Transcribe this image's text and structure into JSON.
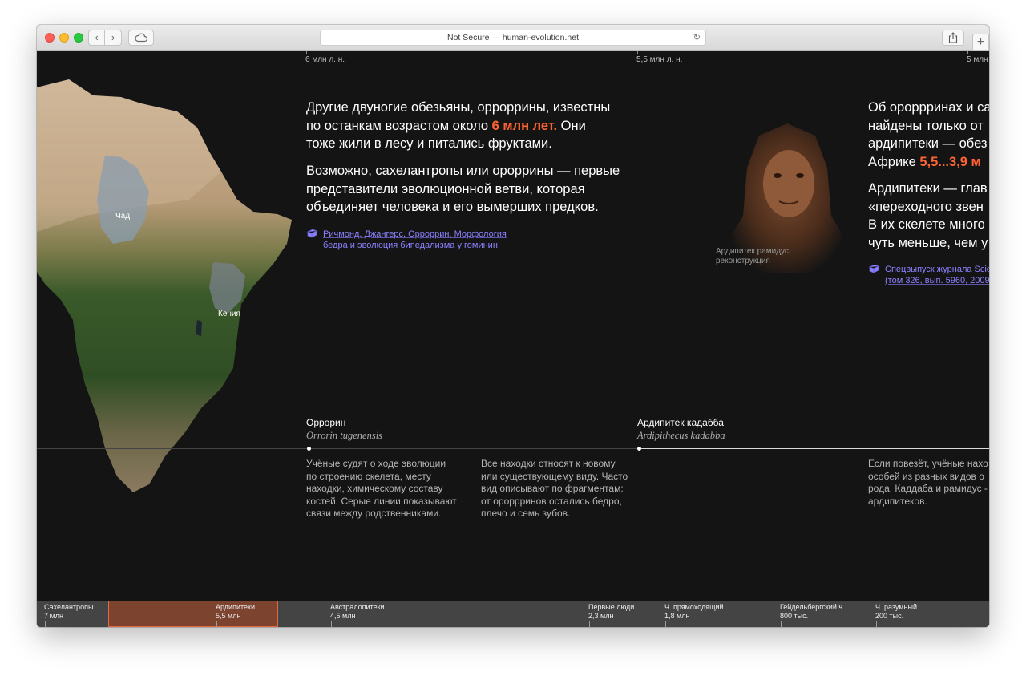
{
  "browser": {
    "address": "Not Secure — human-evolution.net",
    "icons": [
      "back-icon",
      "forward-icon",
      "cloud-icon",
      "reload-icon",
      "share-icon",
      "plus-icon"
    ]
  },
  "timescale": {
    "ticks": [
      "6 млн л. н.",
      "5,5 млн л. н.",
      "5 млн"
    ]
  },
  "map": {
    "regions": [
      "Чад",
      "Кения"
    ]
  },
  "intro": {
    "p1": [
      "Другие двуногие обезьяны, орроррины, известны",
      "по останкам возрастом около ",
      "6 млн лет.",
      " Они",
      "тоже жили в лесу и питались фруктами."
    ],
    "p2": [
      "Возможно, сахелантропы или ороррины — первые",
      "представители эволюционной ветви, которая",
      "объединяет человека и его вымерших предков."
    ],
    "ref": [
      "Ричмонд, Джангерс. Орроррин. Морфология",
      "бедра и эволюция бипедализма у гоминин"
    ]
  },
  "right_text": {
    "p1": [
      "Об ороррринах и са",
      "найдены только от",
      "ардипитеки — обез",
      "Африке ",
      "5,5...3,9 м"
    ],
    "p2": [
      "Ардипитеки — глав",
      "«переходного звен",
      "В их скелете много",
      "чуть меньше, чем у"
    ],
    "ref": [
      "Спецвыпуск журнала Scie",
      "(том 326, вып. 5960, 2009"
    ],
    "portrait_caption": [
      "Ардипитек рамидус,",
      "реконструкция"
    ]
  },
  "species": [
    {
      "name": "Оррорин",
      "latin": "Orrorin tugenensis"
    },
    {
      "name": "Ардипитек кадабба",
      "latin": "Ardipithecus kadabba"
    }
  ],
  "notes": {
    "n1": [
      "Учёные судят о ходе эволюции",
      "по строению скелета, месту",
      "находки, химическому составу",
      "костей. Серые линии показывают",
      "связи между родственниками."
    ],
    "n2": [
      "Все находки относят к новому",
      "или существующему виду. Часто",
      "вид описывают по фрагментам:",
      "от ороррринов остались бедро,",
      "плечо и семь зубов."
    ],
    "n3": [
      "Если повезёт, учёные нахо",
      "особей из разных видов о",
      "рода. Каддаба и рамидус -",
      "ардипитеков."
    ]
  },
  "navigator": {
    "items": [
      {
        "name": "Сахелантропы",
        "age": "7 млн"
      },
      {
        "name": "Ардипитеки",
        "age": "5,5 млн",
        "active": true
      },
      {
        "name": "Австралопитеки",
        "age": "4,5 млн"
      },
      {
        "name": "Первые люди",
        "age": "2,3 млн"
      },
      {
        "name": "Ч. прямоходящий",
        "age": "1,8 млн"
      },
      {
        "name": "Гейдельбергский ч.",
        "age": "800 тыс."
      },
      {
        "name": "Ч. разумный",
        "age": "200 тыс."
      }
    ],
    "highlight_color": "#e26a3e"
  },
  "colors": {
    "accent": "#ff6433",
    "link": "#8c82ff",
    "background": "#141414"
  }
}
